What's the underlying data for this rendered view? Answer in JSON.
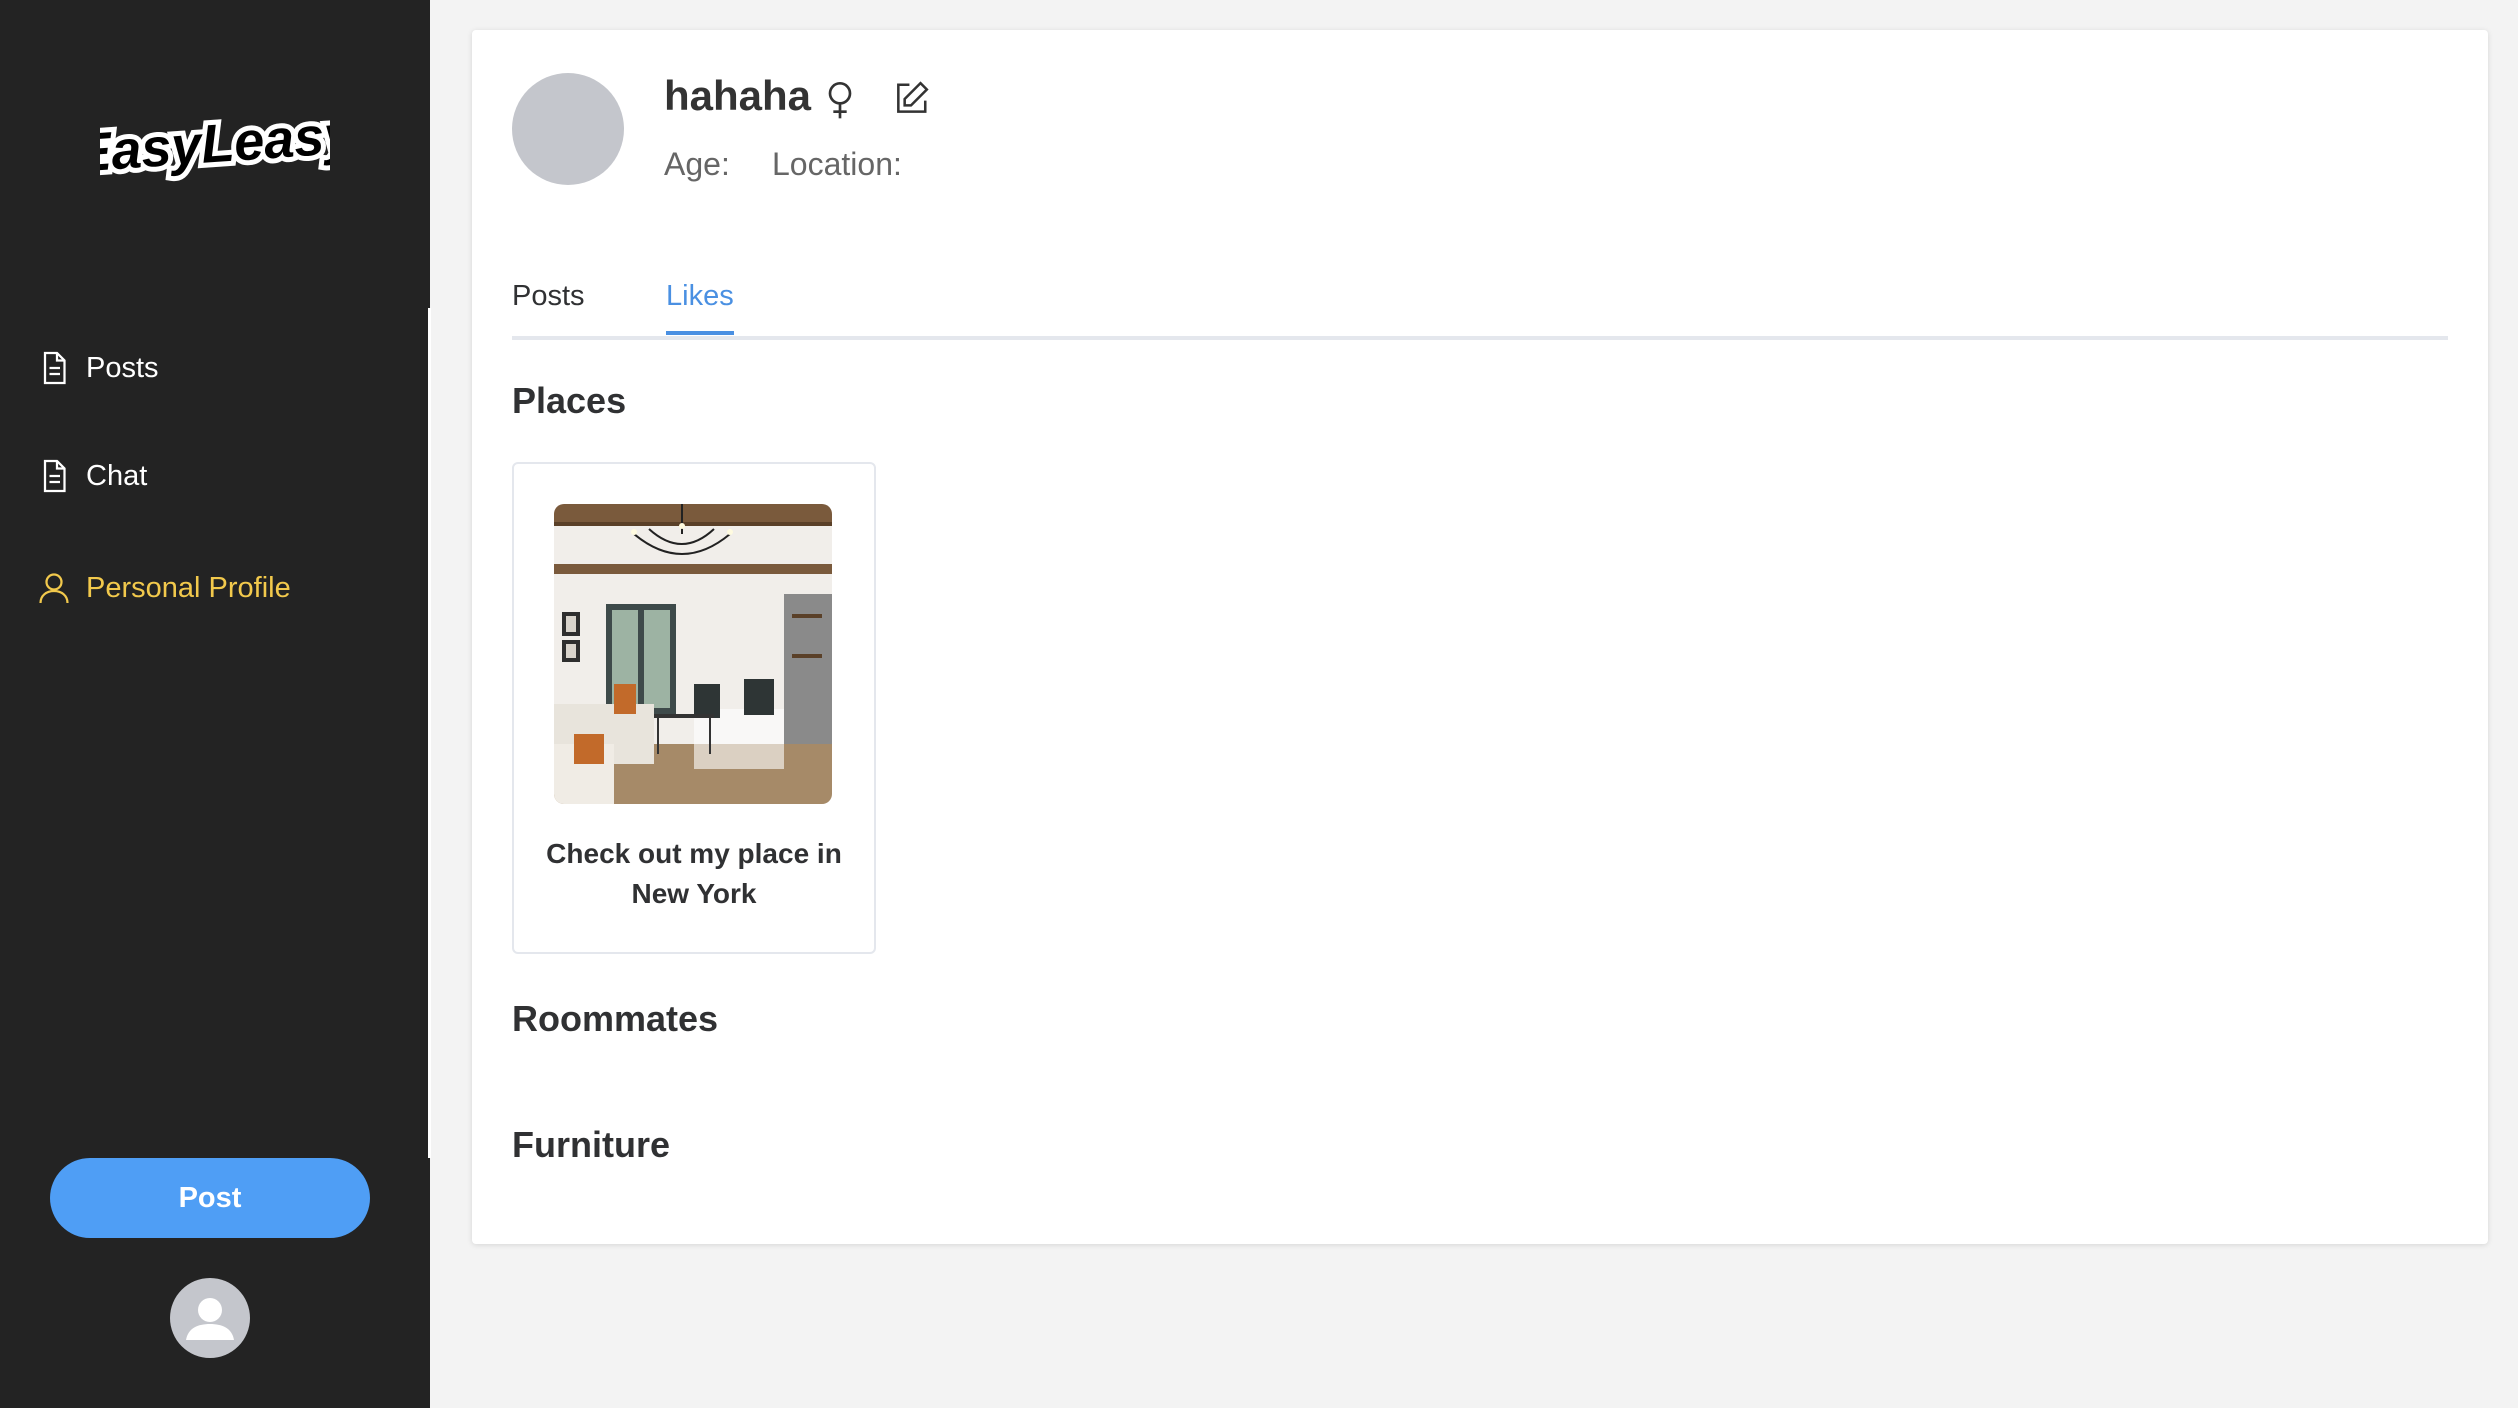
{
  "sidebar": {
    "logo_text": "EasyLeasy",
    "items": [
      {
        "label": "Posts",
        "icon": "document-icon",
        "active": false
      },
      {
        "label": "Chat",
        "icon": "document-icon",
        "active": false
      },
      {
        "label": "Personal Profile",
        "icon": "user-icon",
        "active": true
      }
    ],
    "post_button_label": "Post",
    "active_color": "#f2c94c"
  },
  "profile": {
    "username": "hahaha",
    "gender_icon": "female-icon",
    "edit_icon": "edit-icon",
    "age_label": "Age:",
    "location_label": "Location:"
  },
  "tabs": [
    {
      "label": "Posts",
      "active": false
    },
    {
      "label": "Likes",
      "active": true
    }
  ],
  "sections": {
    "places": {
      "title": "Places",
      "items": [
        {
          "title": "Check out my place in New York"
        }
      ]
    },
    "roommates": {
      "title": "Roommates"
    },
    "furniture": {
      "title": "Furniture"
    }
  },
  "colors": {
    "accent": "#4a90e2",
    "post_button": "#4f9ef5",
    "sidebar_bg": "#232323"
  }
}
